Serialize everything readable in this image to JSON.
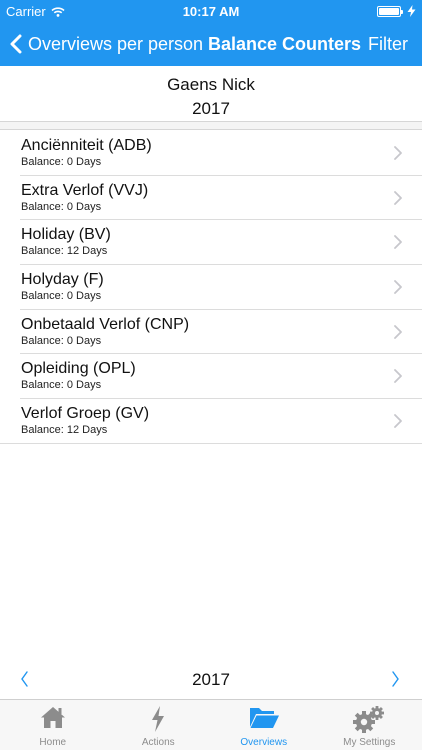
{
  "status_bar": {
    "carrier": "Carrier",
    "time": "10:17 AM"
  },
  "nav": {
    "back_label": "Overviews per person",
    "title": "Balance Counters",
    "filter_label": "Filter"
  },
  "person": {
    "name": "Gaens Nick",
    "year": "2017"
  },
  "counters": [
    {
      "title": "Anciënniteit (ADB)",
      "balance": "Balance: 0 Days"
    },
    {
      "title": "Extra Verlof (VVJ)",
      "balance": "Balance: 0 Days"
    },
    {
      "title": "Holiday (BV)",
      "balance": "Balance: 12 Days"
    },
    {
      "title": "Holyday (F)",
      "balance": "Balance: 0 Days"
    },
    {
      "title": "Onbetaald Verlof (CNP)",
      "balance": "Balance: 0 Days"
    },
    {
      "title": "Opleiding (OPL)",
      "balance": "Balance: 0 Days"
    },
    {
      "title": "Verlof Groep (GV)",
      "balance": "Balance: 12 Days"
    }
  ],
  "year_nav": {
    "year": "2017"
  },
  "tabs": [
    {
      "label": "Home",
      "icon": "home-icon"
    },
    {
      "label": "Actions",
      "icon": "lightning-icon"
    },
    {
      "label": "Overviews",
      "icon": "folder-icon",
      "active": true
    },
    {
      "label": "My Settings",
      "icon": "gear-icon"
    }
  ],
  "colors": {
    "primary": "#2196f0",
    "tab_inactive": "#8c8c8c",
    "separator": "#dcdcdc"
  }
}
